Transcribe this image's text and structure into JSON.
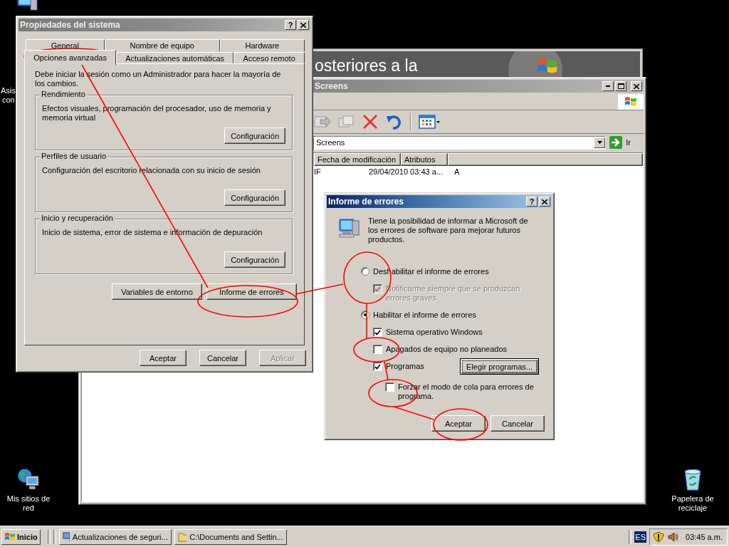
{
  "desktop": {
    "label_fragments": [
      "Asis",
      "con"
    ],
    "icons": [
      {
        "label": "Mis sitios de red",
        "kind": "network"
      },
      {
        "label": "Papelera de reciclaje",
        "kind": "recycle"
      }
    ]
  },
  "update_window": {
    "banner_text": "osteriores a la"
  },
  "explorer": {
    "title": "Screens",
    "active": false,
    "address": "Screens",
    "go_label": "Ir",
    "columns": [
      "Fecha de modificación",
      "Atributos"
    ],
    "rows": [
      {
        "name": "IF",
        "modified": "29/04/2010 03:43 a...",
        "attributes": "A"
      }
    ]
  },
  "system_properties": {
    "title": "Propiedades del sistema",
    "active": false,
    "help_button": "?",
    "tab_rows": [
      [
        {
          "label": "General",
          "selected": false
        },
        {
          "label": "Nombre de equipo",
          "selected": false
        },
        {
          "label": "Hardware",
          "selected": false
        }
      ],
      [
        {
          "label": "Opciones avanzadas",
          "selected": true
        },
        {
          "label": "Actualizaciones automáticas",
          "selected": false
        },
        {
          "label": "Acceso remoto",
          "selected": false
        }
      ]
    ],
    "notice": "Debe iniciar la sesión como un Administrador para hacer la mayoría de los cambios.",
    "groups": [
      {
        "title": "Rendimiento",
        "description": "Efectos visuales, programación del procesador, uso de memoria y memoria virtual",
        "button": "Configuración"
      },
      {
        "title": "Perfiles de usuario",
        "description": "Configuración del escritorio relacionada con su inicio de sesión",
        "button": "Configuración"
      },
      {
        "title": "Inicio y recuperación",
        "description": "Inicio de sistema, error de sistema e información de depuración",
        "button": "Configuración"
      }
    ],
    "extra_buttons": [
      "Variables de entorno",
      "Informe de errores"
    ],
    "buttons": [
      {
        "label": "Aceptar",
        "disabled": false
      },
      {
        "label": "Cancelar",
        "disabled": false
      },
      {
        "label": "Aplicar",
        "disabled": true
      }
    ]
  },
  "error_report": {
    "title": "Informe de errores",
    "active": true,
    "help_button": "?",
    "intro": "Tiene la posibilidad de  informar a Microsoft de los errores de software para mejorar futuros productos.",
    "options": [
      {
        "kind": "radio",
        "label": "Deshabilitar el informe de errores",
        "checked": false,
        "disabled": false,
        "children": [
          {
            "kind": "checkbox",
            "label": "Notificarme siempre que se produzcan errores graves",
            "checked": true,
            "disabled": true
          }
        ]
      },
      {
        "kind": "radio",
        "label": "Habilitar el informe de errores",
        "checked": true,
        "disabled": false,
        "children": [
          {
            "kind": "checkbox",
            "label": "Sistema operativo Windows",
            "checked": true,
            "disabled": false
          },
          {
            "kind": "checkbox",
            "label": "Apagados de equipo no planeados",
            "checked": false,
            "disabled": false
          },
          {
            "kind": "checkbox",
            "label": "Programas",
            "checked": true,
            "disabled": false,
            "button": "Elegir programas...",
            "children": [
              {
                "kind": "checkbox",
                "label": "Forzar el modo de cola para errores de programa.",
                "checked": false,
                "disabled": false
              }
            ]
          }
        ]
      }
    ],
    "buttons": [
      "Aceptar",
      "Cancelar"
    ]
  },
  "taskbar": {
    "start_label": "Inicio",
    "tasks": [
      {
        "label": "Actualizaciones de seguri...",
        "kind": "update"
      },
      {
        "label": "C:\\Documents and Settin...",
        "kind": "folder"
      }
    ],
    "language": "ES",
    "clock": "03:45 a.m."
  }
}
